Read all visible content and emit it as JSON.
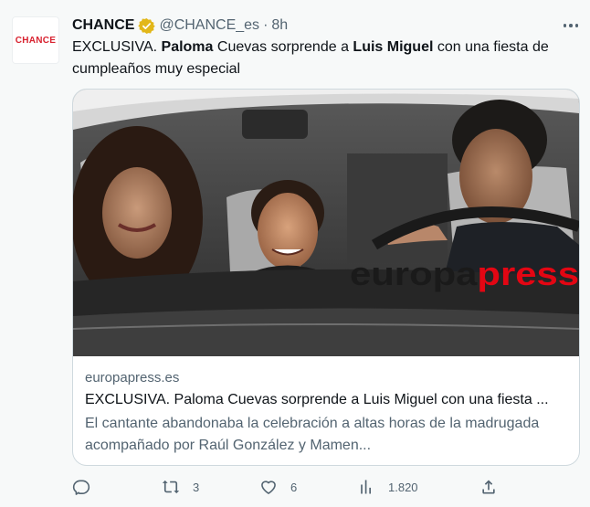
{
  "tweet": {
    "avatar_text": "CHANCE",
    "author_name": "CHANCE",
    "handle": "@CHANCE_es",
    "separator": "·",
    "time": "8h",
    "text": {
      "part1": "EXCLUSIVA. ",
      "bold1": "Paloma",
      "part2": " Cuevas sorprende a ",
      "bold2": "Luis Miguel",
      "part3": " con una fiesta de cumpleaños muy especial"
    }
  },
  "card": {
    "image_watermark": "europa press",
    "domain": "europapress.es",
    "title": "EXCLUSIVA. Paloma Cuevas sorprende a Luis Miguel con una fiesta ...",
    "description": "El cantante abandonaba la celebración a altas horas de la madrugada acompañado por Raúl González y Mamen..."
  },
  "actions": {
    "reply": {
      "icon": "reply-icon",
      "count": ""
    },
    "retweet": {
      "icon": "retweet-icon",
      "count": "3"
    },
    "like": {
      "icon": "heart-icon",
      "count": "6"
    },
    "views": {
      "icon": "views-icon",
      "count": "1.820"
    },
    "share": {
      "icon": "share-icon",
      "count": ""
    }
  },
  "colors": {
    "background": "#f7f9f9",
    "text_primary": "#0f1419",
    "text_secondary": "#536471",
    "brand_red": "#d8222f",
    "verified_gold": "#e2b719",
    "border": "#cfd9de",
    "watermark_red": "#e30613"
  }
}
